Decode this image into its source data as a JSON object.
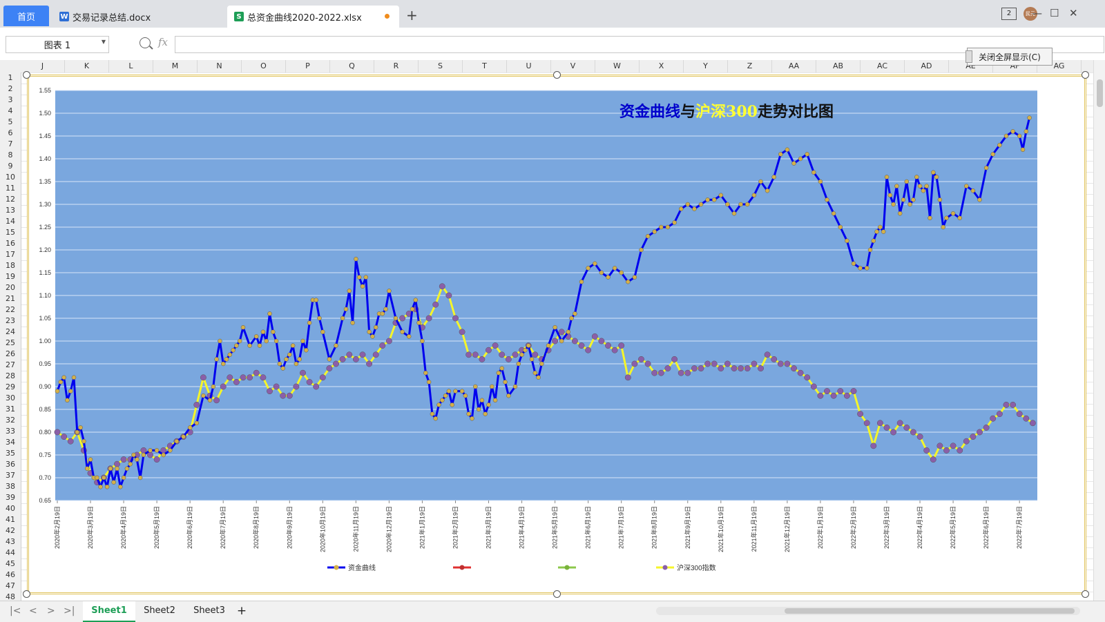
{
  "tabs": {
    "home": "首页",
    "doc1": "交易记录总结.docx",
    "doc2": "总资金曲线2020-2022.xlsx",
    "add": "+"
  },
  "window": {
    "badge": "2",
    "avatar_text": "民元",
    "minimize": "—",
    "maximize": "☐",
    "close": "✕"
  },
  "formula_bar": {
    "name_box": "图表  1",
    "fx": "fx",
    "formula_value": ""
  },
  "close_fullscreen_label": "关闭全屏显示(C)",
  "columns": [
    "J",
    "K",
    "L",
    "M",
    "N",
    "O",
    "P",
    "Q",
    "R",
    "S",
    "T",
    "U",
    "V",
    "W",
    "X",
    "Y",
    "Z",
    "AA",
    "AB",
    "AC",
    "AD",
    "AE",
    "AF",
    "AG"
  ],
  "rows": [
    "1",
    "2",
    "3",
    "4",
    "5",
    "6",
    "7",
    "8",
    "9",
    "10",
    "11",
    "12",
    "13",
    "14",
    "15",
    "16",
    "17",
    "18",
    "19",
    "20",
    "21",
    "22",
    "23",
    "24",
    "25",
    "26",
    "27",
    "28",
    "29",
    "30",
    "31",
    "32",
    "33",
    "34",
    "35",
    "36",
    "37",
    "38",
    "39",
    "40",
    "41",
    "42",
    "43",
    "44",
    "45",
    "46",
    "47",
    "48"
  ],
  "sheets": {
    "s1": "Sheet1",
    "s2": "Sheet2",
    "s3": "Sheet3",
    "add": "+"
  },
  "colors": {
    "plot_bg": "#7aa7de",
    "equity_line": "#0000ee",
    "equity_marker": "#d4b04a",
    "index_line": "#f5f52a",
    "index_marker": "#8a5fa8",
    "title_part1": "#0000cc",
    "title_part2": "#ffff33",
    "title_part3": "#111111"
  },
  "chart_data": {
    "type": "line",
    "title_parts": [
      "资金曲线",
      "与",
      "沪深300",
      "走势对比图"
    ],
    "xlabel": "",
    "ylabel": "",
    "ylim": [
      0.65,
      1.55
    ],
    "yticks": [
      "0.65",
      "0.70",
      "0.75",
      "0.80",
      "0.85",
      "0.90",
      "0.95",
      "1.00",
      "1.05",
      "1.10",
      "1.15",
      "1.20",
      "1.25",
      "1.30",
      "1.35",
      "1.40",
      "1.45",
      "1.50",
      "1.55"
    ],
    "x_tick_labels": [
      "2020年2月19日",
      "2020年3月19日",
      "2020年4月19日",
      "2020年5月19日",
      "2020年6月19日",
      "2020年7月19日",
      "2020年8月19日",
      "2020年9月19日",
      "2020年10月19日",
      "2020年11月19日",
      "2020年12月19日",
      "2021年1月19日",
      "2021年2月19日",
      "2021年3月19日",
      "2021年4月19日",
      "2021年5月19日",
      "2021年6月19日",
      "2021年7月19日",
      "2021年8月19日",
      "2021年9月19日",
      "2021年10月19日",
      "2021年11月19日",
      "2021年12月19日",
      "2022年1月19日",
      "2022年2月19日",
      "2022年3月19日",
      "2022年4月19日",
      "2022年5月19日",
      "2022年6月19日",
      "2022年7月19日"
    ],
    "legend": [
      "资金曲线",
      "",
      "",
      "沪深300指数"
    ],
    "legend_position": "bottom",
    "grid": true,
    "series": [
      {
        "name": "资金曲线",
        "x_month_index": [
          0,
          0.1,
          0.2,
          0.3,
          0.4,
          0.5,
          0.6,
          0.7,
          0.8,
          0.9,
          1.0,
          1.1,
          1.2,
          1.3,
          1.4,
          1.5,
          1.6,
          1.7,
          1.8,
          1.9,
          2.0,
          2.1,
          2.2,
          2.3,
          2.4,
          2.5,
          2.6,
          2.8,
          3.0,
          3.2,
          3.4,
          3.6,
          3.8,
          4.0,
          4.2,
          4.4,
          4.6,
          4.7,
          4.8,
          4.9,
          5.0,
          5.1,
          5.2,
          5.3,
          5.4,
          5.5,
          5.6,
          5.8,
          6.0,
          6.1,
          6.2,
          6.3,
          6.4,
          6.5,
          6.6,
          6.7,
          6.8,
          6.9,
          7.0,
          7.1,
          7.2,
          7.3,
          7.4,
          7.5,
          7.6,
          7.7,
          7.8,
          7.9,
          8.0,
          8.2,
          8.4,
          8.6,
          8.7,
          8.8,
          8.9,
          9.0,
          9.1,
          9.2,
          9.3,
          9.4,
          9.5,
          9.6,
          9.7,
          9.8,
          9.9,
          10.0,
          10.2,
          10.4,
          10.6,
          10.7,
          10.8,
          10.9,
          11.0,
          11.1,
          11.2,
          11.3,
          11.4,
          11.5,
          11.6,
          11.7,
          11.8,
          11.9,
          12.0,
          12.2,
          12.3,
          12.4,
          12.5,
          12.6,
          12.7,
          12.8,
          12.9,
          13.0,
          13.1,
          13.2,
          13.3,
          13.4,
          13.5,
          13.6,
          13.8,
          13.9,
          14.0,
          14.1,
          14.2,
          14.3,
          14.4,
          14.5,
          14.6,
          14.8,
          15.0,
          15.2,
          15.4,
          15.5,
          15.6,
          15.8,
          16.0,
          16.2,
          16.4,
          16.6,
          16.8,
          17.0,
          17.2,
          17.4,
          17.6,
          17.8,
          18.0,
          18.2,
          18.4,
          18.6,
          18.8,
          19.0,
          19.2,
          19.4,
          19.6,
          19.8,
          20.0,
          20.2,
          20.4,
          20.6,
          20.8,
          21.0,
          21.2,
          21.4,
          21.6,
          21.8,
          22.0,
          22.2,
          22.4,
          22.6,
          22.8,
          23.0,
          23.2,
          23.4,
          23.6,
          23.8,
          24.0,
          24.2,
          24.4,
          24.5,
          24.6,
          24.7,
          24.8,
          24.9,
          25.0,
          25.1,
          25.2,
          25.3,
          25.4,
          25.5,
          25.6,
          25.7,
          25.8,
          25.9,
          26.0,
          26.1,
          26.2,
          26.3,
          26.4,
          26.5,
          26.6,
          26.7,
          26.8,
          27.0,
          27.2,
          27.4,
          27.6,
          27.8,
          28.0,
          28.2,
          28.4,
          28.6,
          28.8,
          29.0,
          29.1,
          29.2,
          29.3
        ],
        "values": [
          0.89,
          0.91,
          0.92,
          0.87,
          0.89,
          0.92,
          0.8,
          0.81,
          0.78,
          0.72,
          0.74,
          0.7,
          0.7,
          0.68,
          0.7,
          0.68,
          0.72,
          0.69,
          0.72,
          0.68,
          0.7,
          0.72,
          0.73,
          0.75,
          0.74,
          0.7,
          0.75,
          0.76,
          0.76,
          0.75,
          0.76,
          0.78,
          0.79,
          0.81,
          0.82,
          0.88,
          0.87,
          0.9,
          0.96,
          1.0,
          0.95,
          0.96,
          0.97,
          0.98,
          0.99,
          1.0,
          1.03,
          0.99,
          1.01,
          0.99,
          1.02,
          1.0,
          1.06,
          1.02,
          1.0,
          0.95,
          0.94,
          0.96,
          0.97,
          0.99,
          0.95,
          0.96,
          1.0,
          0.98,
          1.04,
          1.09,
          1.09,
          1.05,
          1.02,
          0.96,
          0.99,
          1.05,
          1.07,
          1.11,
          1.04,
          1.18,
          1.14,
          1.12,
          1.14,
          1.02,
          1.01,
          1.03,
          1.06,
          1.06,
          1.07,
          1.11,
          1.05,
          1.02,
          1.01,
          1.07,
          1.09,
          1.04,
          1.0,
          0.93,
          0.91,
          0.84,
          0.83,
          0.86,
          0.87,
          0.88,
          0.89,
          0.86,
          0.89,
          0.89,
          0.88,
          0.84,
          0.83,
          0.9,
          0.85,
          0.87,
          0.84,
          0.86,
          0.9,
          0.87,
          0.93,
          0.94,
          0.91,
          0.88,
          0.9,
          0.95,
          0.97,
          0.98,
          0.99,
          0.96,
          0.93,
          0.92,
          0.95,
          0.99,
          1.03,
          1.0,
          1.02,
          1.05,
          1.06,
          1.13,
          1.16,
          1.17,
          1.15,
          1.14,
          1.16,
          1.15,
          1.13,
          1.14,
          1.2,
          1.23,
          1.24,
          1.25,
          1.25,
          1.26,
          1.29,
          1.3,
          1.29,
          1.3,
          1.31,
          1.31,
          1.32,
          1.3,
          1.28,
          1.3,
          1.3,
          1.32,
          1.35,
          1.33,
          1.36,
          1.41,
          1.42,
          1.39,
          1.4,
          1.41,
          1.37,
          1.35,
          1.31,
          1.28,
          1.25,
          1.22,
          1.17,
          1.16,
          1.16,
          1.2,
          1.22,
          1.24,
          1.25,
          1.24,
          1.36,
          1.32,
          1.3,
          1.34,
          1.28,
          1.31,
          1.35,
          1.3,
          1.31,
          1.36,
          1.34,
          1.33,
          1.34,
          1.27,
          1.37,
          1.36,
          1.31,
          1.25,
          1.27,
          1.28,
          1.27,
          1.34,
          1.33,
          1.31,
          1.38,
          1.41,
          1.43,
          1.45,
          1.46,
          1.45,
          1.42,
          1.46,
          1.49,
          1.5,
          1.49
        ]
      },
      {
        "name": "沪深300指数",
        "x_month_index": [
          0,
          0.2,
          0.4,
          0.6,
          0.8,
          1.0,
          1.2,
          1.4,
          1.6,
          1.8,
          2.0,
          2.2,
          2.4,
          2.6,
          2.8,
          3.0,
          3.2,
          3.4,
          3.6,
          3.8,
          4.0,
          4.2,
          4.4,
          4.6,
          4.8,
          5.0,
          5.2,
          5.4,
          5.6,
          5.8,
          6.0,
          6.2,
          6.4,
          6.6,
          6.8,
          7.0,
          7.2,
          7.4,
          7.6,
          7.8,
          8.0,
          8.2,
          8.4,
          8.6,
          8.8,
          9.0,
          9.2,
          9.4,
          9.6,
          9.8,
          10.0,
          10.2,
          10.4,
          10.6,
          10.8,
          11.0,
          11.2,
          11.4,
          11.6,
          11.8,
          12.0,
          12.2,
          12.4,
          12.6,
          12.8,
          13.0,
          13.2,
          13.4,
          13.6,
          13.8,
          14.0,
          14.2,
          14.4,
          14.6,
          14.8,
          15.0,
          15.2,
          15.4,
          15.6,
          15.8,
          16.0,
          16.2,
          16.4,
          16.6,
          16.8,
          17.0,
          17.2,
          17.4,
          17.6,
          17.8,
          18.0,
          18.2,
          18.4,
          18.6,
          18.8,
          19.0,
          19.2,
          19.4,
          19.6,
          19.8,
          20.0,
          20.2,
          20.4,
          20.6,
          20.8,
          21.0,
          21.2,
          21.4,
          21.6,
          21.8,
          22.0,
          22.2,
          22.4,
          22.6,
          22.8,
          23.0,
          23.2,
          23.4,
          23.6,
          23.8,
          24.0,
          24.2,
          24.4,
          24.6,
          24.8,
          25.0,
          25.2,
          25.4,
          25.6,
          25.8,
          26.0,
          26.2,
          26.4,
          26.6,
          26.8,
          27.0,
          27.2,
          27.4,
          27.6,
          27.8,
          28.0,
          28.2,
          28.4,
          28.6,
          28.8,
          29.0,
          29.2,
          29.4
        ],
        "values": [
          0.8,
          0.79,
          0.78,
          0.8,
          0.76,
          0.71,
          0.69,
          0.7,
          0.72,
          0.73,
          0.74,
          0.74,
          0.75,
          0.76,
          0.75,
          0.74,
          0.76,
          0.77,
          0.78,
          0.79,
          0.8,
          0.86,
          0.92,
          0.88,
          0.87,
          0.9,
          0.92,
          0.91,
          0.92,
          0.92,
          0.93,
          0.92,
          0.89,
          0.9,
          0.88,
          0.88,
          0.9,
          0.93,
          0.91,
          0.9,
          0.92,
          0.94,
          0.95,
          0.96,
          0.97,
          0.96,
          0.97,
          0.95,
          0.97,
          0.99,
          1.0,
          1.04,
          1.05,
          1.06,
          1.07,
          1.03,
          1.05,
          1.08,
          1.12,
          1.1,
          1.05,
          1.02,
          0.97,
          0.97,
          0.96,
          0.98,
          0.99,
          0.97,
          0.96,
          0.97,
          0.98,
          0.99,
          0.97,
          0.96,
          0.98,
          1.0,
          1.02,
          1.01,
          1.0,
          0.99,
          0.98,
          1.01,
          1.0,
          0.99,
          0.98,
          0.99,
          0.92,
          0.95,
          0.96,
          0.95,
          0.93,
          0.93,
          0.94,
          0.96,
          0.93,
          0.93,
          0.94,
          0.94,
          0.95,
          0.95,
          0.94,
          0.95,
          0.94,
          0.94,
          0.94,
          0.95,
          0.94,
          0.97,
          0.96,
          0.95,
          0.95,
          0.94,
          0.93,
          0.92,
          0.9,
          0.88,
          0.89,
          0.88,
          0.89,
          0.88,
          0.89,
          0.84,
          0.82,
          0.77,
          0.82,
          0.81,
          0.8,
          0.82,
          0.81,
          0.8,
          0.79,
          0.76,
          0.74,
          0.77,
          0.76,
          0.77,
          0.76,
          0.78,
          0.79,
          0.8,
          0.81,
          0.83,
          0.84,
          0.86,
          0.86,
          0.84,
          0.83,
          0.82,
          0.81
        ]
      }
    ]
  }
}
